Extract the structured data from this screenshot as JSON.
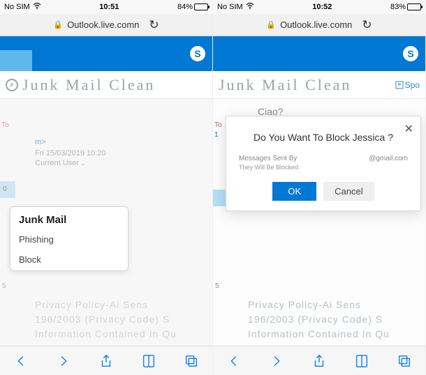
{
  "left": {
    "status": {
      "carrier": "No SIM",
      "time": "10:51",
      "battery_pct": "84%"
    },
    "url": "Outlook.live.comn",
    "page_title": "Junk Mail Clean",
    "popover": {
      "header": "Junk Mail",
      "items": [
        "Phishing",
        "Block"
      ]
    },
    "message": {
      "to_label": "To",
      "line_frag": "m>",
      "date": "Fri 15/03/2019 10:20",
      "user": "Current User"
    },
    "side_count": "5",
    "side_zero": "0",
    "footer": {
      "l1": "Privacy Policy-Ai Sens",
      "l2": "196/2003 (Privacy Code) S",
      "l3": "Information Contained In Qu"
    }
  },
  "right": {
    "status": {
      "carrier": "No SIM",
      "time": "10:52",
      "battery_pct": "83%"
    },
    "url": "Outlook.live.comn",
    "page_title": "Junk Mail Clean",
    "spo": "Spo",
    "subject": "Ciao?",
    "modal": {
      "title": "Do You Want To Block Jessica ?",
      "msg_label": "Messages Sent By",
      "msg_email": "@gmail.com",
      "msg_line2": "They Will Be Blocked.",
      "ok": "OK",
      "cancel": "Cancel"
    },
    "to_label": "To",
    "side_one": "1",
    "side_count": "5",
    "footer": {
      "l1": "Privacy Policy-Ai Sens",
      "l2": "196/2003 (Privacy Code) S",
      "l3": "Information Contained In Qu"
    }
  }
}
